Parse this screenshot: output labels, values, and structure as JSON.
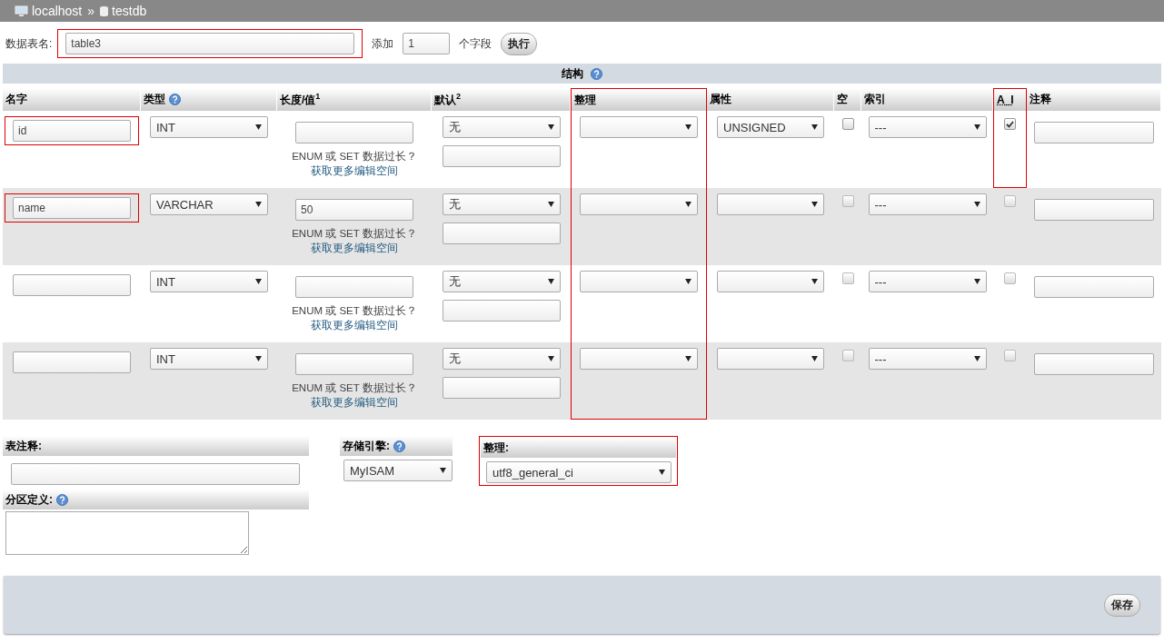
{
  "breadcrumb": {
    "separator": "»",
    "items": [
      {
        "label": "localhost",
        "kind": "server"
      },
      {
        "label": "testdb",
        "kind": "database"
      }
    ]
  },
  "table_name": {
    "label": "数据表名:",
    "value": "table3",
    "highlighted": true
  },
  "add_fields": {
    "label": "添加",
    "value": "1",
    "suffix": "个字段",
    "button": "执行"
  },
  "structure": {
    "title": "结构",
    "help": true,
    "columns": [
      {
        "label": "名字",
        "kind": "name",
        "help": false,
        "highlighted": false
      },
      {
        "label": "类型",
        "kind": "type",
        "help": true,
        "highlighted": false
      },
      {
        "label": "长度/值$^{1}$",
        "kind": "length",
        "help": false,
        "highlighted": false
      },
      {
        "label": "默认$^{2}$",
        "kind": "default",
        "help": false,
        "highlighted": false
      },
      {
        "label": "整理",
        "kind": "collation",
        "help": false,
        "highlighted": true
      },
      {
        "label": "属性",
        "kind": "attributes",
        "help": false,
        "highlighted": false
      },
      {
        "label": "空",
        "kind": "null",
        "help": false,
        "highlighted": false
      },
      {
        "label": "索引",
        "kind": "index",
        "help": false,
        "highlighted": false
      },
      {
        "label": "A_I",
        "kind": "ai",
        "help": false,
        "highlighted": true,
        "abbr": true
      },
      {
        "label": "注释",
        "kind": "comment",
        "help": false,
        "highlighted": false
      }
    ],
    "rows": [
      {
        "name": "id",
        "type": "INT",
        "default": "无",
        "attributes": "UNSIGNED",
        "null": false,
        "index": "---",
        "ai": true,
        "note": "ENUM 或 SET 数据过长？",
        "note_link": "获取更多编辑空间",
        "highlight": {
          "name": true,
          "collation": true,
          "ai": true
        }
      },
      {
        "name": "name",
        "type": "VARCHAR",
        "length": "50",
        "default": "无",
        "null": false,
        "index": "---",
        "ai": false,
        "note": "ENUM 或 SET 数据过长？",
        "note_link": "获取更多编辑空间",
        "highlight": {
          "name": true,
          "collation": true,
          "ai": false
        }
      },
      {
        "type": "INT",
        "default": "无",
        "null": false,
        "index": "---",
        "ai": false,
        "note": "ENUM 或 SET 数据过长？",
        "note_link": "获取更多编辑空间",
        "highlight": {
          "name": false,
          "collation": true,
          "ai": false
        }
      },
      {
        "type": "INT",
        "default": "无",
        "null": false,
        "index": "---",
        "ai": false,
        "note": "ENUM 或 SET 数据过长？",
        "note_link": "获取更多编辑空间",
        "highlight": {
          "name": false,
          "collation": true,
          "ai": false
        }
      }
    ]
  },
  "table_comment": {
    "label": "表注释:"
  },
  "partition": {
    "label": "分区定义:",
    "help": true
  },
  "storage_engine": {
    "label": "存储引擎:",
    "help": true,
    "value": "MyISAM"
  },
  "collation": {
    "label": "整理:",
    "value": "utf8_general_ci",
    "highlighted": true
  },
  "save_button": "保存"
}
